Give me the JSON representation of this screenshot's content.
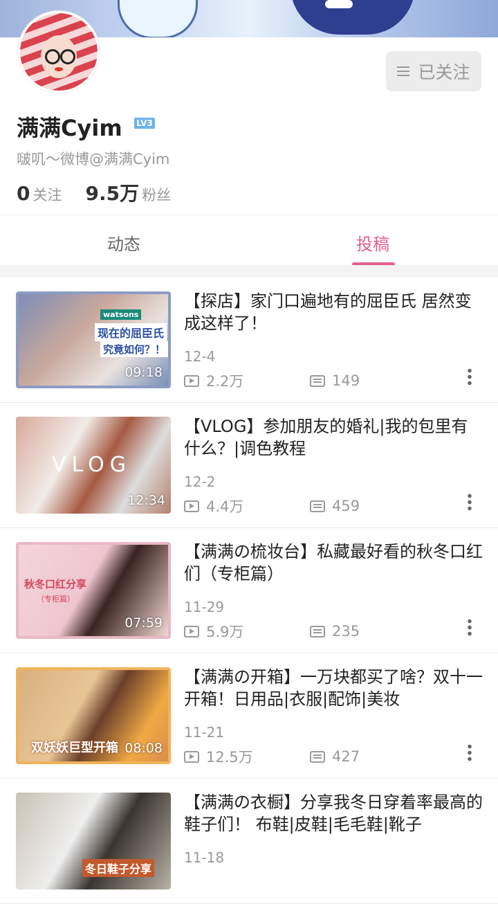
{
  "profile": {
    "name": "满满Cyim",
    "level": "LV3",
    "bio": "啵叽～微博@满满Cyim",
    "following_count": "0",
    "following_label": "关注",
    "fans_count": "9.5万",
    "fans_label": "粉丝",
    "follow_button": "已关注"
  },
  "tabs": [
    {
      "label": "动态",
      "active": false
    },
    {
      "label": "投稿",
      "active": true
    }
  ],
  "colors": {
    "accent": "#e5618a",
    "muted": "#999999"
  },
  "videos": [
    {
      "title": "【探店】家门口遍地有的屈臣氏 居然变成这样了！",
      "date": "12-4",
      "views": "2.2万",
      "danmaku": "149",
      "duration": "09:18",
      "thumb_text": [
        "watsons",
        "现在的屈臣氏",
        "究竟如何？！"
      ]
    },
    {
      "title": "【VLOG】参加朋友的婚礼|我的包里有什么？|调色教程",
      "date": "12-2",
      "views": "4.4万",
      "danmaku": "459",
      "duration": "12:34",
      "thumb_text": [
        "VLOG"
      ]
    },
    {
      "title": "【满满の梳妆台】私藏最好看的秋冬口红们（专柜篇）",
      "date": "11-29",
      "views": "5.9万",
      "danmaku": "235",
      "duration": "07:59",
      "thumb_text": [
        "秋冬口红分享",
        "（专柜篇）"
      ]
    },
    {
      "title": "【满满の开箱】一万块都买了啥？双十一开箱！日用品|衣服|配饰|美妆",
      "date": "11-21",
      "views": "12.5万",
      "danmaku": "427",
      "duration": "08:08",
      "thumb_text": [
        "双妖妖巨型开箱"
      ]
    },
    {
      "title": "【满满の衣橱】分享我冬日穿着率最高的鞋子们！ 布鞋|皮鞋|毛毛鞋|靴子",
      "date": "11-18",
      "views": "",
      "danmaku": "",
      "duration": "",
      "thumb_text": [
        "冬日鞋子分享"
      ]
    }
  ]
}
